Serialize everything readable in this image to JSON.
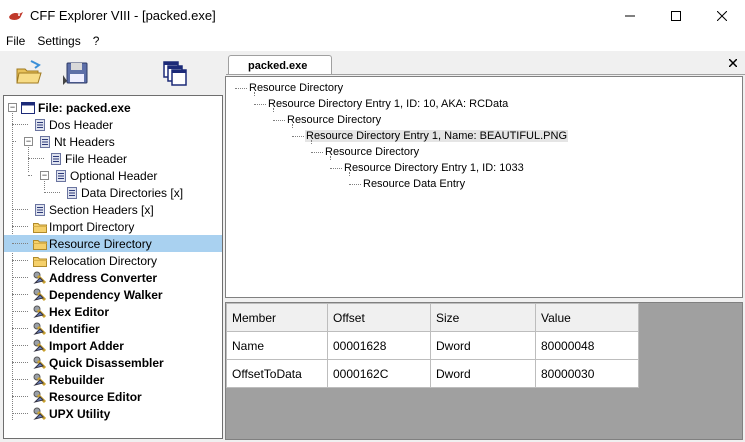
{
  "window": {
    "title": "CFF Explorer VIII - [packed.exe]"
  },
  "menu": [
    "File",
    "Settings",
    "?"
  ],
  "tree": {
    "root": "File: packed.exe",
    "items": [
      {
        "label": "Dos Header",
        "bold": false,
        "icon": "header-icon"
      },
      {
        "label": "Nt Headers",
        "bold": false,
        "icon": "header-icon"
      },
      {
        "label": "File Header",
        "bold": false,
        "icon": "header-icon"
      },
      {
        "label": "Optional Header",
        "bold": false,
        "icon": "header-icon"
      },
      {
        "label": "Data Directories [x]",
        "bold": false,
        "icon": "header-icon"
      },
      {
        "label": "Section Headers [x]",
        "bold": false,
        "icon": "header-icon"
      },
      {
        "label": "Import Directory",
        "bold": false,
        "icon": "folder-icon"
      },
      {
        "label": "Resource Directory",
        "bold": false,
        "icon": "folder-icon"
      },
      {
        "label": "Relocation Directory",
        "bold": false,
        "icon": "folder-icon"
      },
      {
        "label": "Address Converter",
        "bold": true,
        "icon": "tool-icon"
      },
      {
        "label": "Dependency Walker",
        "bold": true,
        "icon": "tool-icon"
      },
      {
        "label": "Hex Editor",
        "bold": true,
        "icon": "tool-icon"
      },
      {
        "label": "Identifier",
        "bold": true,
        "icon": "tool-icon"
      },
      {
        "label": "Import Adder",
        "bold": true,
        "icon": "tool-icon"
      },
      {
        "label": "Quick Disassembler",
        "bold": true,
        "icon": "tool-icon"
      },
      {
        "label": "Rebuilder",
        "bold": true,
        "icon": "tool-icon"
      },
      {
        "label": "Resource Editor",
        "bold": true,
        "icon": "tool-icon"
      },
      {
        "label": "UPX Utility",
        "bold": true,
        "icon": "tool-icon"
      }
    ],
    "selected": "Resource Directory"
  },
  "tab": {
    "label": "packed.exe"
  },
  "resource_tree": [
    "Resource Directory",
    "Resource Directory Entry 1, ID: 10, AKA: RCData",
    "Resource Directory",
    "Resource Directory Entry 1, Name: BEAUTIFUL.PNG",
    "Resource Directory",
    "Resource Directory Entry 1, ID: 1033",
    "Resource Data Entry"
  ],
  "grid": {
    "headers": [
      "Member",
      "Offset",
      "Size",
      "Value"
    ],
    "rows": [
      [
        "Name",
        "00001628",
        "Dword",
        "80000048"
      ],
      [
        "OffsetToData",
        "0000162C",
        "Dword",
        "80000030"
      ]
    ]
  },
  "colors": {
    "selection": "#a9d1f0",
    "grid_background": "#a0a0a0",
    "folder": "#f5d06a"
  }
}
